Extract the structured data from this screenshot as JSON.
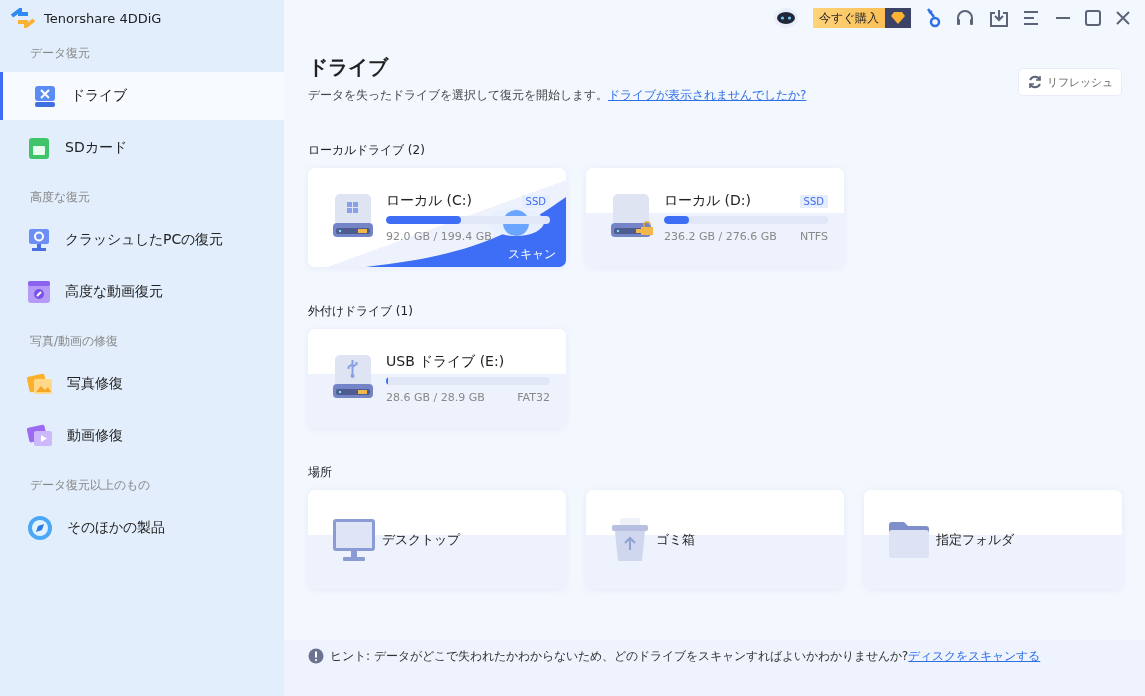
{
  "app": {
    "title": "Tenorshare 4DDiG"
  },
  "topbar": {
    "buy_label": "今すぐ購入"
  },
  "sidebar": {
    "groups": [
      {
        "heading": "データ復元",
        "items": [
          {
            "label": "ドライブ",
            "kind": "drive",
            "selected": true
          },
          {
            "label": "SDカード",
            "kind": "sd",
            "selected": false
          }
        ]
      },
      {
        "heading": "高度な復元",
        "items": [
          {
            "label": "クラッシュしたPCの復元",
            "kind": "pc",
            "selected": false
          },
          {
            "label": "高度な動画復元",
            "kind": "video-fix",
            "selected": false
          }
        ]
      },
      {
        "heading": "写真/動画の修復",
        "items": [
          {
            "label": "写真修復",
            "kind": "photo",
            "selected": false
          },
          {
            "label": "動画修復",
            "kind": "video",
            "selected": false
          }
        ]
      },
      {
        "heading": "データ復元以上のもの",
        "items": [
          {
            "label": "そのほかの製品",
            "kind": "compass",
            "selected": false
          }
        ]
      }
    ]
  },
  "main": {
    "title": "ドライブ",
    "subtitle": "データを失ったドライブを選択して復元を開始します。",
    "help_link": "ドライブが表示されませんでしたか?",
    "refresh_label": "リフレッシュ"
  },
  "sections": [
    {
      "heading": "ローカルドライブ (2)",
      "drives": [
        {
          "name": "ローカル (C:)",
          "kind": "windows",
          "badge": "SSD",
          "level": 0.46,
          "usage": "92.0 GB / 199.4 GB",
          "highlighted": true,
          "scan_label": "スキャン",
          "locked": false
        },
        {
          "name": "ローカル (D:)",
          "kind": "plain",
          "badge": "SSD",
          "level": 0.15,
          "usage": "236.2 GB / 276.6 GB",
          "filesystem": "NTFS",
          "highlighted": false,
          "locked": true
        }
      ]
    },
    {
      "heading": "外付けドライブ (1)",
      "drives": [
        {
          "name": "USB ドライブ (E:)",
          "kind": "usb",
          "level": 0.01,
          "usage": "28.6 GB / 28.9 GB",
          "filesystem": "FAT32",
          "highlighted": false,
          "locked": false
        }
      ]
    }
  ],
  "locations": {
    "heading": "場所",
    "items": [
      {
        "label": "デスクトップ",
        "kind": "desktop"
      },
      {
        "label": "ゴミ箱",
        "kind": "trash"
      },
      {
        "label": "指定フォルダ",
        "kind": "folder"
      }
    ]
  },
  "hint": {
    "text": "ヒント:  データがどこで失われたかわからないため、どのドライブをスキャンすればよいかわかりませんか?",
    "link": "ディスクをスキャンする"
  }
}
